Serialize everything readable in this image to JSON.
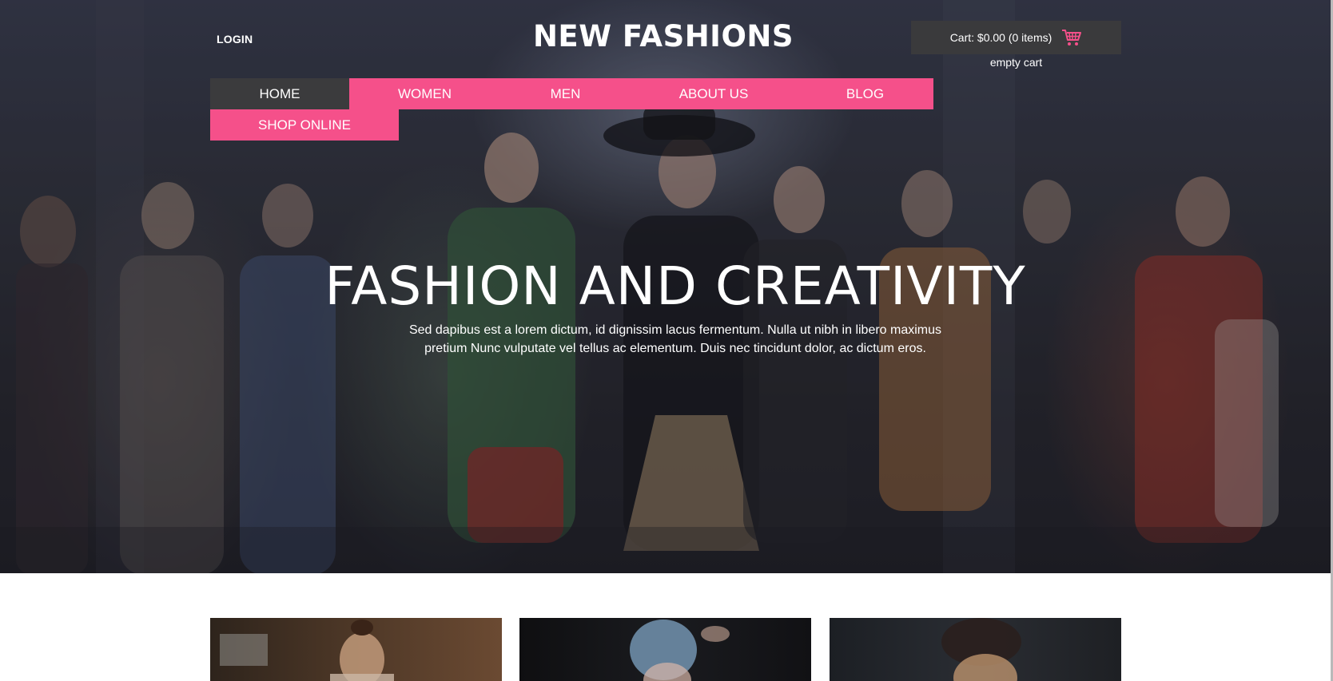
{
  "header": {
    "login_label": "LOGIN",
    "site_title": "NEW FASHIONS",
    "cart_label": "Cart: $0.00 (0 items)",
    "cart_icon": "shopping-cart-icon",
    "empty_cart_label": "empty cart"
  },
  "nav": {
    "items": [
      {
        "label": "HOME",
        "active": true
      },
      {
        "label": "WOMEN",
        "active": false
      },
      {
        "label": "MEN",
        "active": false
      },
      {
        "label": "ABOUT US",
        "active": false
      },
      {
        "label": "BLOG",
        "active": false
      },
      {
        "label": "SHOP ONLINE",
        "active": false
      }
    ]
  },
  "hero": {
    "title": "FASHION AND CREATIVITY",
    "text_line1": "Sed dapibus est a lorem dictum, id dignissim lacus fermentum. Nulla ut nibh in libero maximus",
    "text_line2": "pretium Nunc vulputate vel tellus ac elementum. Duis nec tincidunt dolor, ac dictum eros."
  },
  "colors": {
    "accent": "#f5508a",
    "nav_active": "#3b3b3d",
    "cart_bg": "#3a3a3c"
  }
}
